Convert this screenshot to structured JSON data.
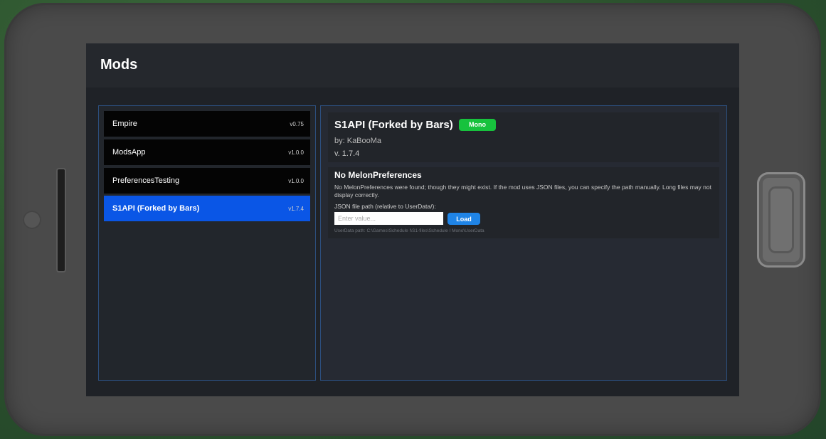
{
  "app": {
    "title": "Mods"
  },
  "mods": [
    {
      "name": "Empire",
      "version": "v0.75",
      "selected": false
    },
    {
      "name": "ModsApp",
      "version": "v1.0.0",
      "selected": false
    },
    {
      "name": "PreferencesTesting",
      "version": "v1.0.0",
      "selected": false
    },
    {
      "name": "S1API (Forked by Bars)",
      "version": "v1.7.4",
      "selected": true
    }
  ],
  "details": {
    "title": "S1API (Forked by Bars)",
    "badge": "Mono",
    "author": "by: KaBooMa",
    "version": "v. 1.7.4"
  },
  "preferences": {
    "title": "No MelonPreferences",
    "description": "No MelonPreferences were found; though they might exist. If the mod uses JSON files, you can specify the path manually. Long files may not display correctly.",
    "json_label": "JSON file path (relative to UserData/):",
    "input_value": "",
    "input_placeholder": "Enter value...",
    "load_label": "Load",
    "userdata_path": "UserData path: C:\\Games\\Schedule I\\S1-files\\Schedule I Mono\\UserData"
  },
  "colors": {
    "selected_item": "#0a56e6",
    "badge": "#17c23d",
    "load_button": "#1f84e6",
    "panel_border": "#2c4f7e"
  }
}
